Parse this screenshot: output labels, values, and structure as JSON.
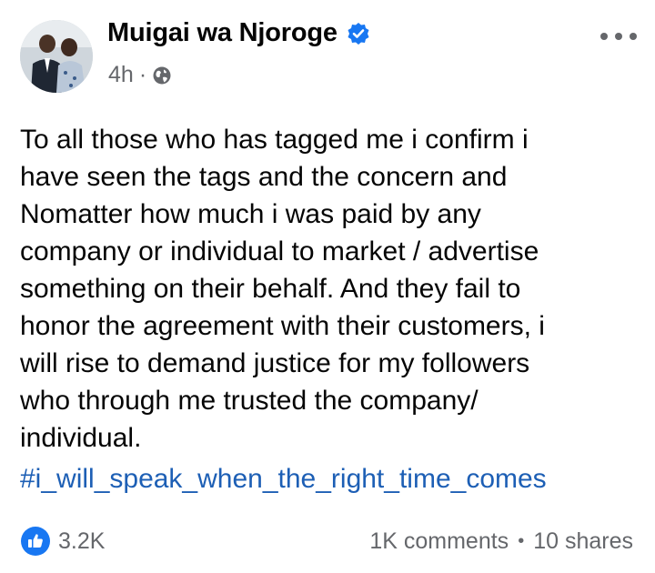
{
  "post": {
    "author": "Muigai wa Njoroge",
    "time": "4h",
    "meta_separator": "·",
    "body": "To all those who has tagged me i confirm i\nhave seen the tags and the concern and\nNomatter how much i was paid by any\ncompany or individual to market / advertise\nsomething on their behalf. And they fail to\nhonor the agreement with their customers,  i\nwill rise to demand justice for my followers\nwho through me trusted the company/\nindividual.",
    "hashtag": "#i_will_speak_when_the_right_time_comes"
  },
  "footer": {
    "reactions_count": "3.2K",
    "comments": "1K comments",
    "separator": "•",
    "shares": "10 shares"
  },
  "icons": {
    "verified": "verified-badge-icon",
    "audience": "globe-icon",
    "more": "more-options-icon",
    "reaction": "like-icon"
  },
  "colors": {
    "hashtag": "#1d5fb5",
    "verified": "#1877f2",
    "like": "#1877f2",
    "secondary_text": "#65676b"
  }
}
